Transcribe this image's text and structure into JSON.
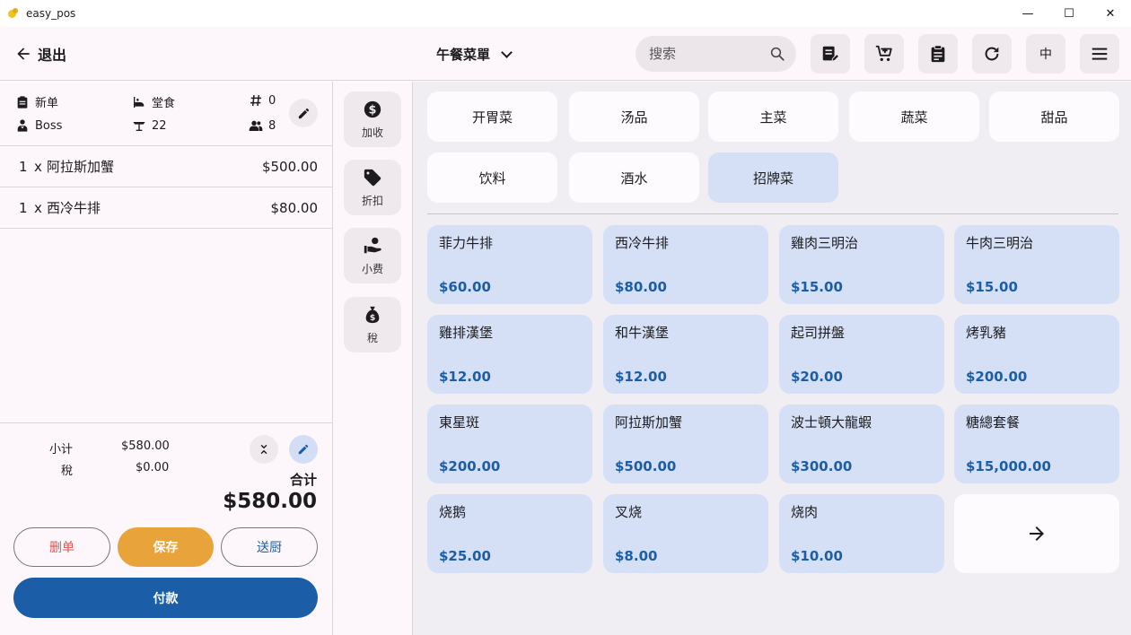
{
  "window": {
    "title": "easy_pos",
    "minimize": "—",
    "maximize": "☐",
    "close": "✕"
  },
  "appbar": {
    "back_label": "退出",
    "menu_label": "午餐菜單",
    "search_placeholder": "搜索",
    "lang_label": "中",
    "icons": [
      "receipt-edit-icon",
      "cart-add-icon",
      "clipboard-icon",
      "refresh-icon",
      "language-button",
      "hamburger-menu-icon"
    ]
  },
  "order_info": {
    "order_type": "新单",
    "dine_mode": "堂食",
    "order_number": "0",
    "staff": "Boss",
    "table": "22",
    "guests": "8"
  },
  "order_lines": [
    {
      "qty": "1",
      "x": "x",
      "name": "阿拉斯加蟹",
      "price": "$500.00"
    },
    {
      "qty": "1",
      "x": "x",
      "name": "西冷牛排",
      "price": "$80.00"
    }
  ],
  "summary": {
    "subtotal_label": "小计",
    "subtotal_value": "$580.00",
    "tax_label": "稅",
    "tax_value": "$0.00",
    "total_label": "合计",
    "total_value": "$580.00"
  },
  "buttons": {
    "delete": "删单",
    "save": "保存",
    "kitchen": "送厨",
    "pay": "付款"
  },
  "actions": [
    {
      "label": "加收",
      "icon": "dollar-circle-icon"
    },
    {
      "label": "折扣",
      "icon": "tag-icon"
    },
    {
      "label": "小费",
      "icon": "tip-hand-icon"
    },
    {
      "label": "稅",
      "icon": "money-bag-icon"
    }
  ],
  "categories": [
    {
      "label": "开胃菜",
      "active": false
    },
    {
      "label": "汤品",
      "active": false
    },
    {
      "label": "主菜",
      "active": false
    },
    {
      "label": "蔬菜",
      "active": false
    },
    {
      "label": "甜品",
      "active": false
    },
    {
      "label": "饮料",
      "active": false
    },
    {
      "label": "酒水",
      "active": false
    },
    {
      "label": "招牌菜",
      "active": true
    }
  ],
  "items": [
    {
      "name": "菲力牛排",
      "price": "$60.00"
    },
    {
      "name": "西冷牛排",
      "price": "$80.00"
    },
    {
      "name": "雞肉三明治",
      "price": "$15.00"
    },
    {
      "name": "牛肉三明治",
      "price": "$15.00"
    },
    {
      "name": "雞排漢堡",
      "price": "$12.00"
    },
    {
      "name": "和牛漢堡",
      "price": "$12.00"
    },
    {
      "name": "起司拼盤",
      "price": "$20.00"
    },
    {
      "name": "烤乳豬",
      "price": "$200.00"
    },
    {
      "name": "東星斑",
      "price": "$200.00"
    },
    {
      "name": "阿拉斯加蟹",
      "price": "$500.00"
    },
    {
      "name": "波士頓大龍蝦",
      "price": "$300.00"
    },
    {
      "name": "糖總套餐",
      "price": "$15,000.00"
    },
    {
      "name": "烧鹅",
      "price": "$25.00"
    },
    {
      "name": "叉烧",
      "price": "$8.00"
    },
    {
      "name": "烧肉",
      "price": "$10.00"
    }
  ],
  "colors": {
    "primary": "#1b5ea7",
    "save": "#e8a33a",
    "delete_text": "#d9534f",
    "item_card": "#d5e0f6"
  }
}
